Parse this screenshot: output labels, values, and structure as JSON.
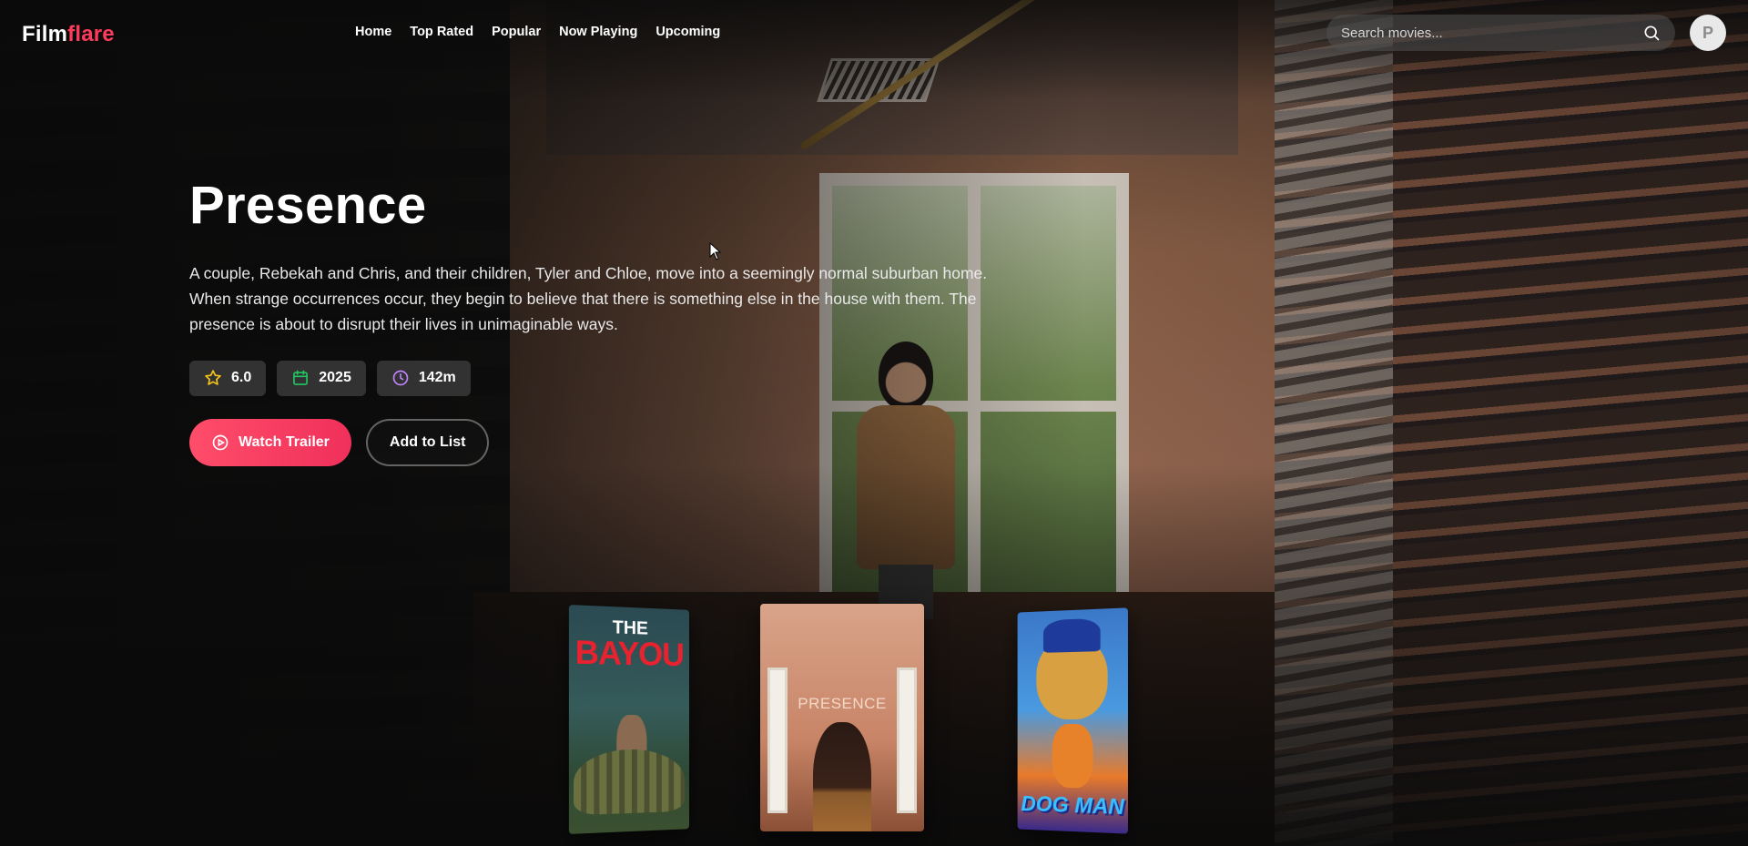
{
  "app": {
    "logo_main": "Film",
    "logo_accent": "flare"
  },
  "nav": {
    "items": [
      "Home",
      "Top Rated",
      "Popular",
      "Now Playing",
      "Upcoming"
    ]
  },
  "search": {
    "placeholder": "Search movies...",
    "icon": "search-icon"
  },
  "user": {
    "avatar_initial": "P"
  },
  "hero": {
    "title": "Presence",
    "overview": "A couple, Rebekah and Chris, and their children, Tyler and Chloe, move into a seemingly normal suburban home. When strange occurrences occur, they begin to believe that there is something else in the house with them. The presence is about to disrupt their lives in unimaginable ways.",
    "rating": "6.0",
    "year": "2025",
    "runtime": "142m",
    "watch_trailer_label": "Watch Trailer",
    "add_to_list_label": "Add to List"
  },
  "posters": [
    {
      "title_line1": "THE",
      "title_line2": "BAYOU"
    },
    {
      "title": "PRESENCE"
    },
    {
      "title": "DOG MAN"
    }
  ],
  "colors": {
    "accent": "#ff3b5c",
    "star": "#f5c518",
    "calendar": "#22c55e",
    "clock": "#c084fc"
  }
}
